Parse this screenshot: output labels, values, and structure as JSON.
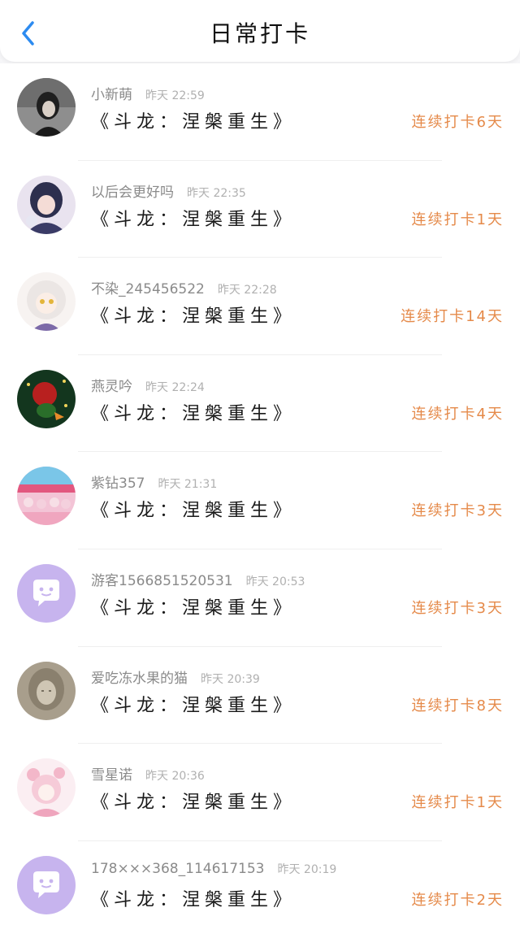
{
  "header": {
    "title": "日常打卡",
    "back_icon": "chevron-left-icon"
  },
  "colors": {
    "accent_blue": "#2d8bf0",
    "streak_orange": "#e58a4a",
    "default_avatar_bg": "#c7b4ee"
  },
  "entries": [
    {
      "name": "小新萌",
      "time": "昨天 22:59",
      "book": "《斗龙：涅槃重生》",
      "streak": "连续打卡6天",
      "avatar": "photo"
    },
    {
      "name": "以后会更好吗",
      "time": "昨天 22:35",
      "book": "《斗龙：涅槃重生》",
      "streak": "连续打卡1天",
      "avatar": "photo"
    },
    {
      "name": "不染_245456522",
      "time": "昨天 22:28",
      "book": "《斗龙：涅槃重生》",
      "streak": "连续打卡14天",
      "avatar": "photo"
    },
    {
      "name": "燕灵吟",
      "time": "昨天 22:24",
      "book": "《斗龙：涅槃重生》",
      "streak": "连续打卡4天",
      "avatar": "photo"
    },
    {
      "name": "紫钻357",
      "time": "昨天 21:31",
      "book": "《斗龙：涅槃重生》",
      "streak": "连续打卡3天",
      "avatar": "photo"
    },
    {
      "name": "游客1566851520531",
      "time": "昨天 20:53",
      "book": "《斗龙：涅槃重生》",
      "streak": "连续打卡3天",
      "avatar": "chat-bubble-default"
    },
    {
      "name": "爱吃冻水果的猫",
      "time": "昨天 20:39",
      "book": "《斗龙：涅槃重生》",
      "streak": "连续打卡8天",
      "avatar": "photo"
    },
    {
      "name": "雪星诺",
      "time": "昨天 20:36",
      "book": "《斗龙：涅槃重生》",
      "streak": "连续打卡1天",
      "avatar": "photo"
    },
    {
      "name": "178×××368_114617153",
      "time": "昨天 20:19",
      "book": "《斗龙：涅槃重生》",
      "streak": "连续打卡2天",
      "avatar": "chat-bubble-default"
    }
  ]
}
